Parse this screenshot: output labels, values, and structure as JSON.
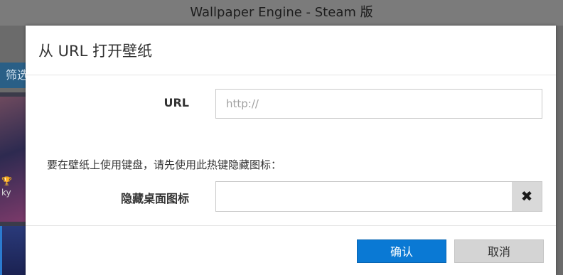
{
  "window": {
    "title": "Wallpaper Engine - Steam 版"
  },
  "background": {
    "toolbar_label": "筛选",
    "thumb_label": "ky",
    "trophy_icon": "trophy-icon"
  },
  "dialog": {
    "title": "从 URL 打开壁纸",
    "url_label": "URL",
    "url_placeholder": "http://",
    "url_value": "",
    "hint": "要在壁纸上使用键盘，请先使用此热键隐藏图标：",
    "hide_icons_label": "隐藏桌面图标",
    "hide_icons_value": "",
    "clear_icon": "close-icon",
    "ok_label": "确认",
    "cancel_label": "取消"
  },
  "colors": {
    "accent": "#0a79d4",
    "toolbar": "#2a5f86"
  }
}
